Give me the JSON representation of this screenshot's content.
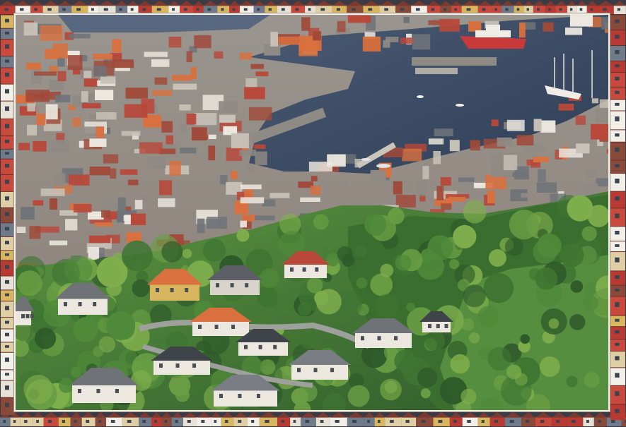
{
  "image": {
    "kind": "photograph",
    "subject": "harbour-city-aerial",
    "frame": "decorative-painted-house-border"
  },
  "palette": {
    "water": "#3a4b63",
    "water_light": "#56677f",
    "forest_dark": "#2f5a2a",
    "forest": "#4f8a3a",
    "forest_light": "#7fae4c",
    "roof_red": "#b8483a",
    "roof_orange": "#d9703e",
    "roof_grey": "#6f7378",
    "wall_white": "#ece8e0",
    "wall_yellow": "#d8b660",
    "ship_red": "#c83a3a",
    "frame_light": "#f3f0ea"
  }
}
